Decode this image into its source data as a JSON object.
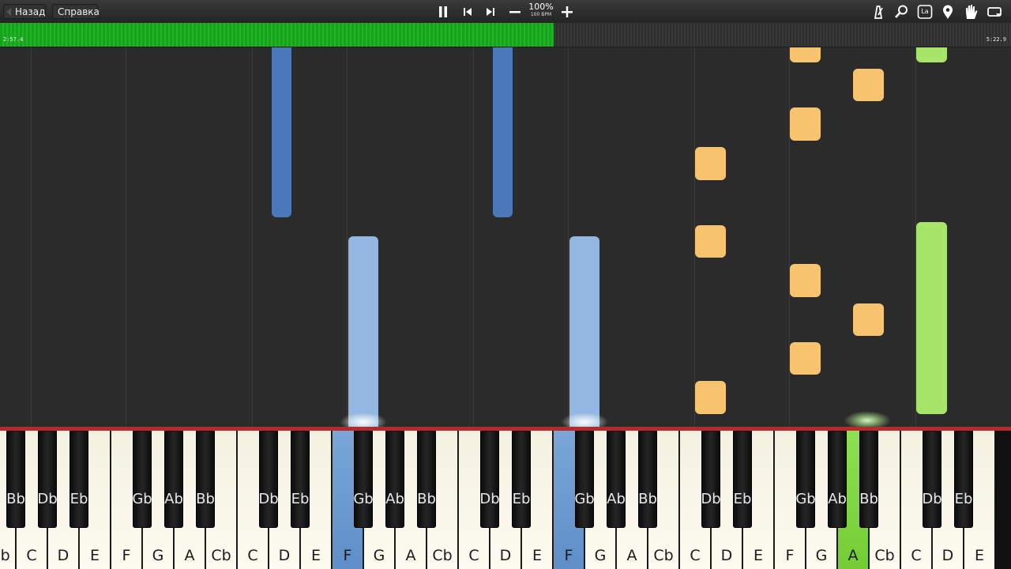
{
  "toolbar": {
    "back_label": "Назад",
    "help_label": "Справка",
    "speed_percent": "100%",
    "speed_bpm": "100 BPM",
    "icons": [
      "pause-icon",
      "rewind-icon",
      "skip-forward-icon",
      "minus-icon",
      "plus-icon",
      "metronome-icon",
      "search-icon",
      "label-icon",
      "map-pin-icon",
      "hand-icon",
      "loop-icon"
    ],
    "label_icon_text": "La"
  },
  "progress": {
    "current_time": "2:57.4",
    "total_time": "5:22.9",
    "fraction": 0.548,
    "accent": "#1fb323"
  },
  "colors": {
    "left_hand": "#4a78b8",
    "left_hand_light": "#93b7e0",
    "right_hand": "#f7c36e",
    "green_track": "#a6e46a"
  },
  "keyboard": {
    "white_keys": [
      "Cb",
      "C",
      "D",
      "E",
      "F",
      "G",
      "A",
      "Cb",
      "C",
      "D",
      "E",
      "F",
      "G",
      "A",
      "Cb",
      "C",
      "D",
      "E",
      "F",
      "G",
      "A",
      "Cb",
      "C",
      "D",
      "E",
      "F",
      "G",
      "A",
      "Cb",
      "C",
      "D",
      "E"
    ],
    "black_keys": [
      {
        "label": "Bb",
        "after": 0
      },
      {
        "label": "Db",
        "after": 1
      },
      {
        "label": "Eb",
        "after": 2
      },
      {
        "label": "Gb",
        "after": 4
      },
      {
        "label": "Ab",
        "after": 5
      },
      {
        "label": "Bb",
        "after": 6
      },
      {
        "label": "Db",
        "after": 8
      },
      {
        "label": "Eb",
        "after": 9
      },
      {
        "label": "Gb",
        "after": 11
      },
      {
        "label": "Ab",
        "after": 12
      },
      {
        "label": "Bb",
        "after": 13
      },
      {
        "label": "Db",
        "after": 15
      },
      {
        "label": "Eb",
        "after": 16
      },
      {
        "label": "Gb",
        "after": 18
      },
      {
        "label": "Ab",
        "after": 19
      },
      {
        "label": "Bb",
        "after": 20
      },
      {
        "label": "Db",
        "after": 22
      },
      {
        "label": "Eb",
        "after": 23
      },
      {
        "label": "Gb",
        "after": 25
      },
      {
        "label": "Ab",
        "after": 26
      },
      {
        "label": "Bb",
        "after": 27
      },
      {
        "label": "Db",
        "after": 29
      },
      {
        "label": "Eb",
        "after": 30
      }
    ],
    "pressed": [
      {
        "index": 11,
        "color": "blue"
      },
      {
        "index": 18,
        "color": "blue"
      },
      {
        "index": 27,
        "color": "green"
      }
    ]
  }
}
